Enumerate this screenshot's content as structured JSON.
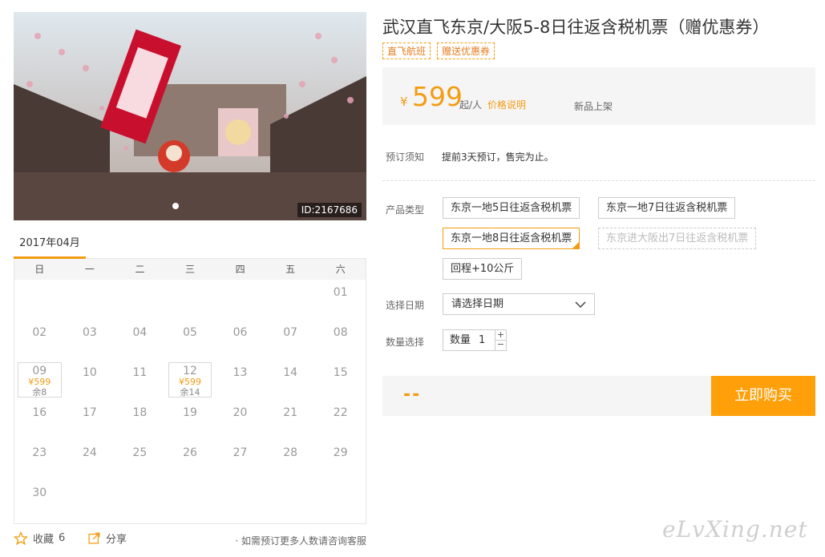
{
  "product": {
    "title": "武汉直飞东京/大阪5-8日往返含税机票（赠优惠券）",
    "tags": [
      "直飞航班",
      "赠送优惠券"
    ],
    "photo_id": "ID:2167686"
  },
  "price": {
    "currency": "¥",
    "amount": "599",
    "unit": "起/人",
    "explain_link": "价格说明",
    "status": "新品上架"
  },
  "booking_notice": {
    "label": "预订须知",
    "text": "提前3天预订，售完为止。"
  },
  "product_type": {
    "label": "产品类型",
    "options": [
      {
        "label": "东京一地5日往返含税机票",
        "state": "normal"
      },
      {
        "label": "东京一地7日往返含税机票",
        "state": "normal"
      },
      {
        "label": "东京一地8日往返含税机票",
        "state": "selected"
      },
      {
        "label": "东京进大阪出7日往返含税机票",
        "state": "disabled"
      },
      {
        "label": "回程+10公斤",
        "state": "normal"
      }
    ]
  },
  "date_select": {
    "label": "选择日期",
    "placeholder": "请选择日期"
  },
  "quantity": {
    "label": "数量选择",
    "prefix": "数量",
    "value": "1",
    "plus": "+",
    "minus": "−"
  },
  "buy_bar": {
    "total_placeholder": "--",
    "buy_label": "立即购买"
  },
  "calendar": {
    "month": "2017年04月",
    "weekdays": [
      "日",
      "一",
      "二",
      "三",
      "四",
      "五",
      "六"
    ],
    "cells": [
      {
        "day": ""
      },
      {
        "day": ""
      },
      {
        "day": ""
      },
      {
        "day": ""
      },
      {
        "day": ""
      },
      {
        "day": ""
      },
      {
        "day": "01"
      },
      {
        "day": "02"
      },
      {
        "day": "03"
      },
      {
        "day": "04"
      },
      {
        "day": "05"
      },
      {
        "day": "06"
      },
      {
        "day": "07"
      },
      {
        "day": "08"
      },
      {
        "day": "09",
        "price": "¥599",
        "remain": "余8"
      },
      {
        "day": "10"
      },
      {
        "day": "11"
      },
      {
        "day": "12",
        "price": "¥599",
        "remain": "余14"
      },
      {
        "day": "13"
      },
      {
        "day": "14"
      },
      {
        "day": "15"
      },
      {
        "day": "16"
      },
      {
        "day": "17"
      },
      {
        "day": "18"
      },
      {
        "day": "19"
      },
      {
        "day": "20"
      },
      {
        "day": "21"
      },
      {
        "day": "22"
      },
      {
        "day": "23"
      },
      {
        "day": "24"
      },
      {
        "day": "25"
      },
      {
        "day": "26"
      },
      {
        "day": "27"
      },
      {
        "day": "28"
      },
      {
        "day": "29"
      },
      {
        "day": "30"
      }
    ]
  },
  "footer": {
    "favorite_label": "收藏",
    "favorite_count": "6",
    "share_label": "分享",
    "consult_text": "· 如需预订更多人数请咨询客服"
  },
  "watermark": "eLvXing.net",
  "colors": {
    "accent": "#f39c12",
    "buy_button": "#ffa00a",
    "panel_bg": "#f5f5f5"
  }
}
